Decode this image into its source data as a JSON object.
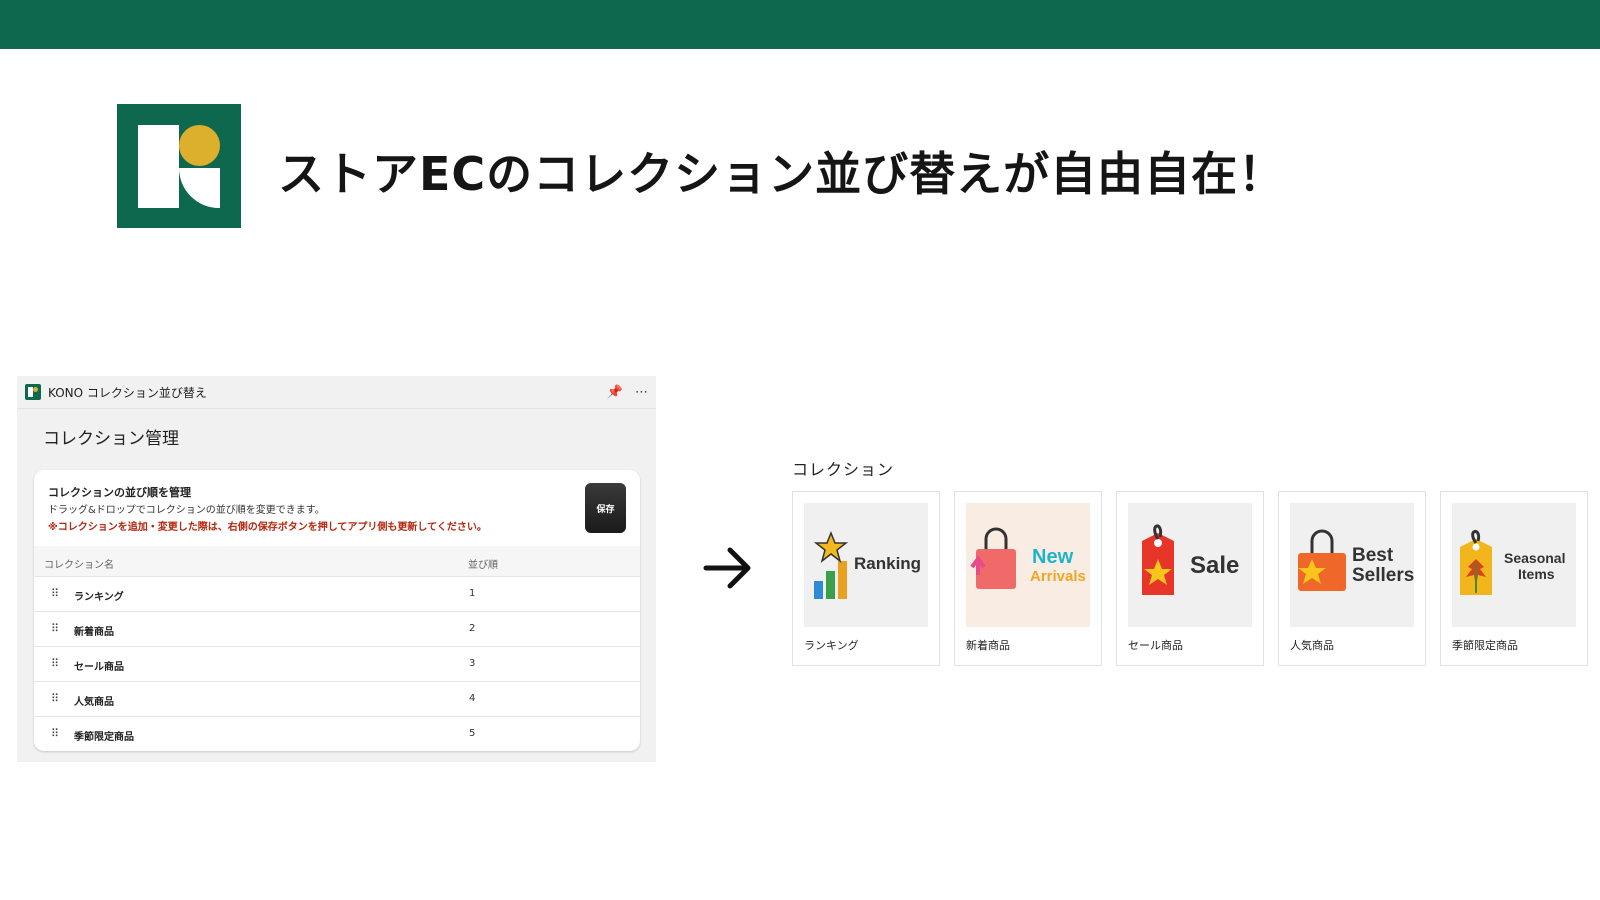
{
  "headline": "ストアECのコレクション並び替えが自由自在！",
  "colors": {
    "brand": "#0e684e",
    "accent": "#dcb02d",
    "warning": "#b5260e"
  },
  "admin": {
    "app_name": "KONO コレクション並び替え",
    "page_title": "コレクション管理",
    "card_title": "コレクションの並び順を管理",
    "card_desc": "ドラッグ&ドロップでコレクションの並び順を変更できます。",
    "card_warning": "※コレクションを追加・変更した際は、右側の保存ボタンを押してアプリ側も更新してください。",
    "save_label": "保存",
    "columns": {
      "name": "コレクション名",
      "order": "並び順"
    },
    "rows": [
      {
        "name": "ランキング",
        "order": "1"
      },
      {
        "name": "新着商品",
        "order": "2"
      },
      {
        "name": "セール商品",
        "order": "3"
      },
      {
        "name": "人気商品",
        "order": "4"
      },
      {
        "name": "季節限定商品",
        "order": "5"
      }
    ]
  },
  "store": {
    "heading": "コレクション",
    "collections": [
      {
        "label": "ランキング",
        "image_text": "Ranking",
        "icon": "trophy-chart-icon"
      },
      {
        "label": "新着商品",
        "image_text_1": "New",
        "image_text_2": "Arrivals",
        "icon": "shopping-bag-icon"
      },
      {
        "label": "セール商品",
        "image_text": "Sale",
        "icon": "price-tag-icon"
      },
      {
        "label": "人気商品",
        "image_text_1": "Best",
        "image_text_2": "Sellers",
        "icon": "star-bag-icon"
      },
      {
        "label": "季節限定商品",
        "image_text_1": "Seasonal",
        "image_text_2": "Items",
        "icon": "leaf-tag-icon"
      }
    ]
  }
}
